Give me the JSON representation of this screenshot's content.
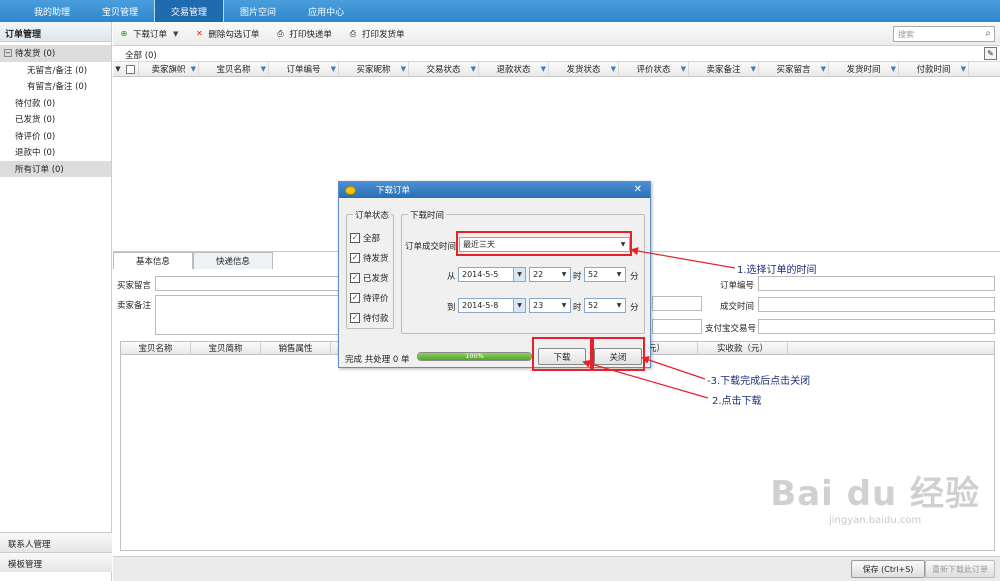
{
  "topnav": [
    "我的助理",
    "宝贝管理",
    "交易管理",
    "图片空间",
    "应用中心"
  ],
  "left": {
    "title": "订单管理",
    "tree": [
      {
        "label": "待发货 (0)",
        "level": 0,
        "expander": "−",
        "selected": true
      },
      {
        "label": "无留言/备注 (0)",
        "level": 1
      },
      {
        "label": "有留言/备注 (0)",
        "level": 1
      },
      {
        "label": "待付款 (0)",
        "level": 0
      },
      {
        "label": "已发货 (0)",
        "level": 0
      },
      {
        "label": "待评价 (0)",
        "level": 0
      },
      {
        "label": "退款中 (0)",
        "level": 0
      },
      {
        "label": "所有订单 (0)",
        "level": 0,
        "selected": true
      }
    ],
    "footer1": "联系人管理",
    "footer2": "模板管理"
  },
  "toolbar": {
    "download": "下载订单",
    "delete": "删除勾选订单",
    "print_express": "打印快递单",
    "print_invoice": "打印发货单",
    "search_placeholder": "搜索"
  },
  "all_label": "全部 (0)",
  "columns": [
    "卖家旗帜",
    "宝贝名称",
    "订单编号",
    "买家昵称",
    "交易状态",
    "退款状态",
    "发货状态",
    "评价状态",
    "卖家备注",
    "买家留言",
    "发货时间",
    "付款时间"
  ],
  "detail": {
    "tab_basic": "基本信息",
    "tab_express": "快递信息",
    "buyer_msg": "买家留言",
    "seller_note": "卖家备注",
    "order_no": "订单编号",
    "deal_time": "成交时间",
    "alipay_no": "支付宝交易号",
    "product_cols": [
      "宝贝名称",
      "宝贝简称",
      "销售属性"
    ],
    "paid_tail": "元）",
    "received": "实收款（元）"
  },
  "bottom": {
    "save": "保存 (Ctrl+S)",
    "redownload": "重新下载此订单"
  },
  "dialog": {
    "title": "下载订单",
    "order_status_legend": "订单状态",
    "statuses": [
      "全部",
      "待发货",
      "已发货",
      "待评价",
      "待付款"
    ],
    "time_legend": "下载时间",
    "deal_time_label": "订单成交时间",
    "deal_time_value": "最近三天",
    "from_label": "从",
    "to_label": "到",
    "from_date": "2014-5-5",
    "from_hour": "22",
    "from_min": "52",
    "to_date": "2014-5-8",
    "to_hour": "23",
    "to_min": "52",
    "hour_unit": "时",
    "min_unit": "分",
    "status_text": "完成 共处理 0 单",
    "progress": 1.0,
    "progress_label": "100%",
    "download_btn": "下载",
    "close_btn": "关闭"
  },
  "annotations": {
    "a1": "1.选择订单的时间",
    "a2": "2.点击下载",
    "a3": "-3.下载完成后点击关闭"
  },
  "watermark": {
    "big": "Bai du 经验",
    "small": "jingyan.baidu.com"
  },
  "colors": {
    "nav": "#2f86cc",
    "annotation_red": "#e8202a",
    "annotation_text": "#1b2f7a"
  }
}
